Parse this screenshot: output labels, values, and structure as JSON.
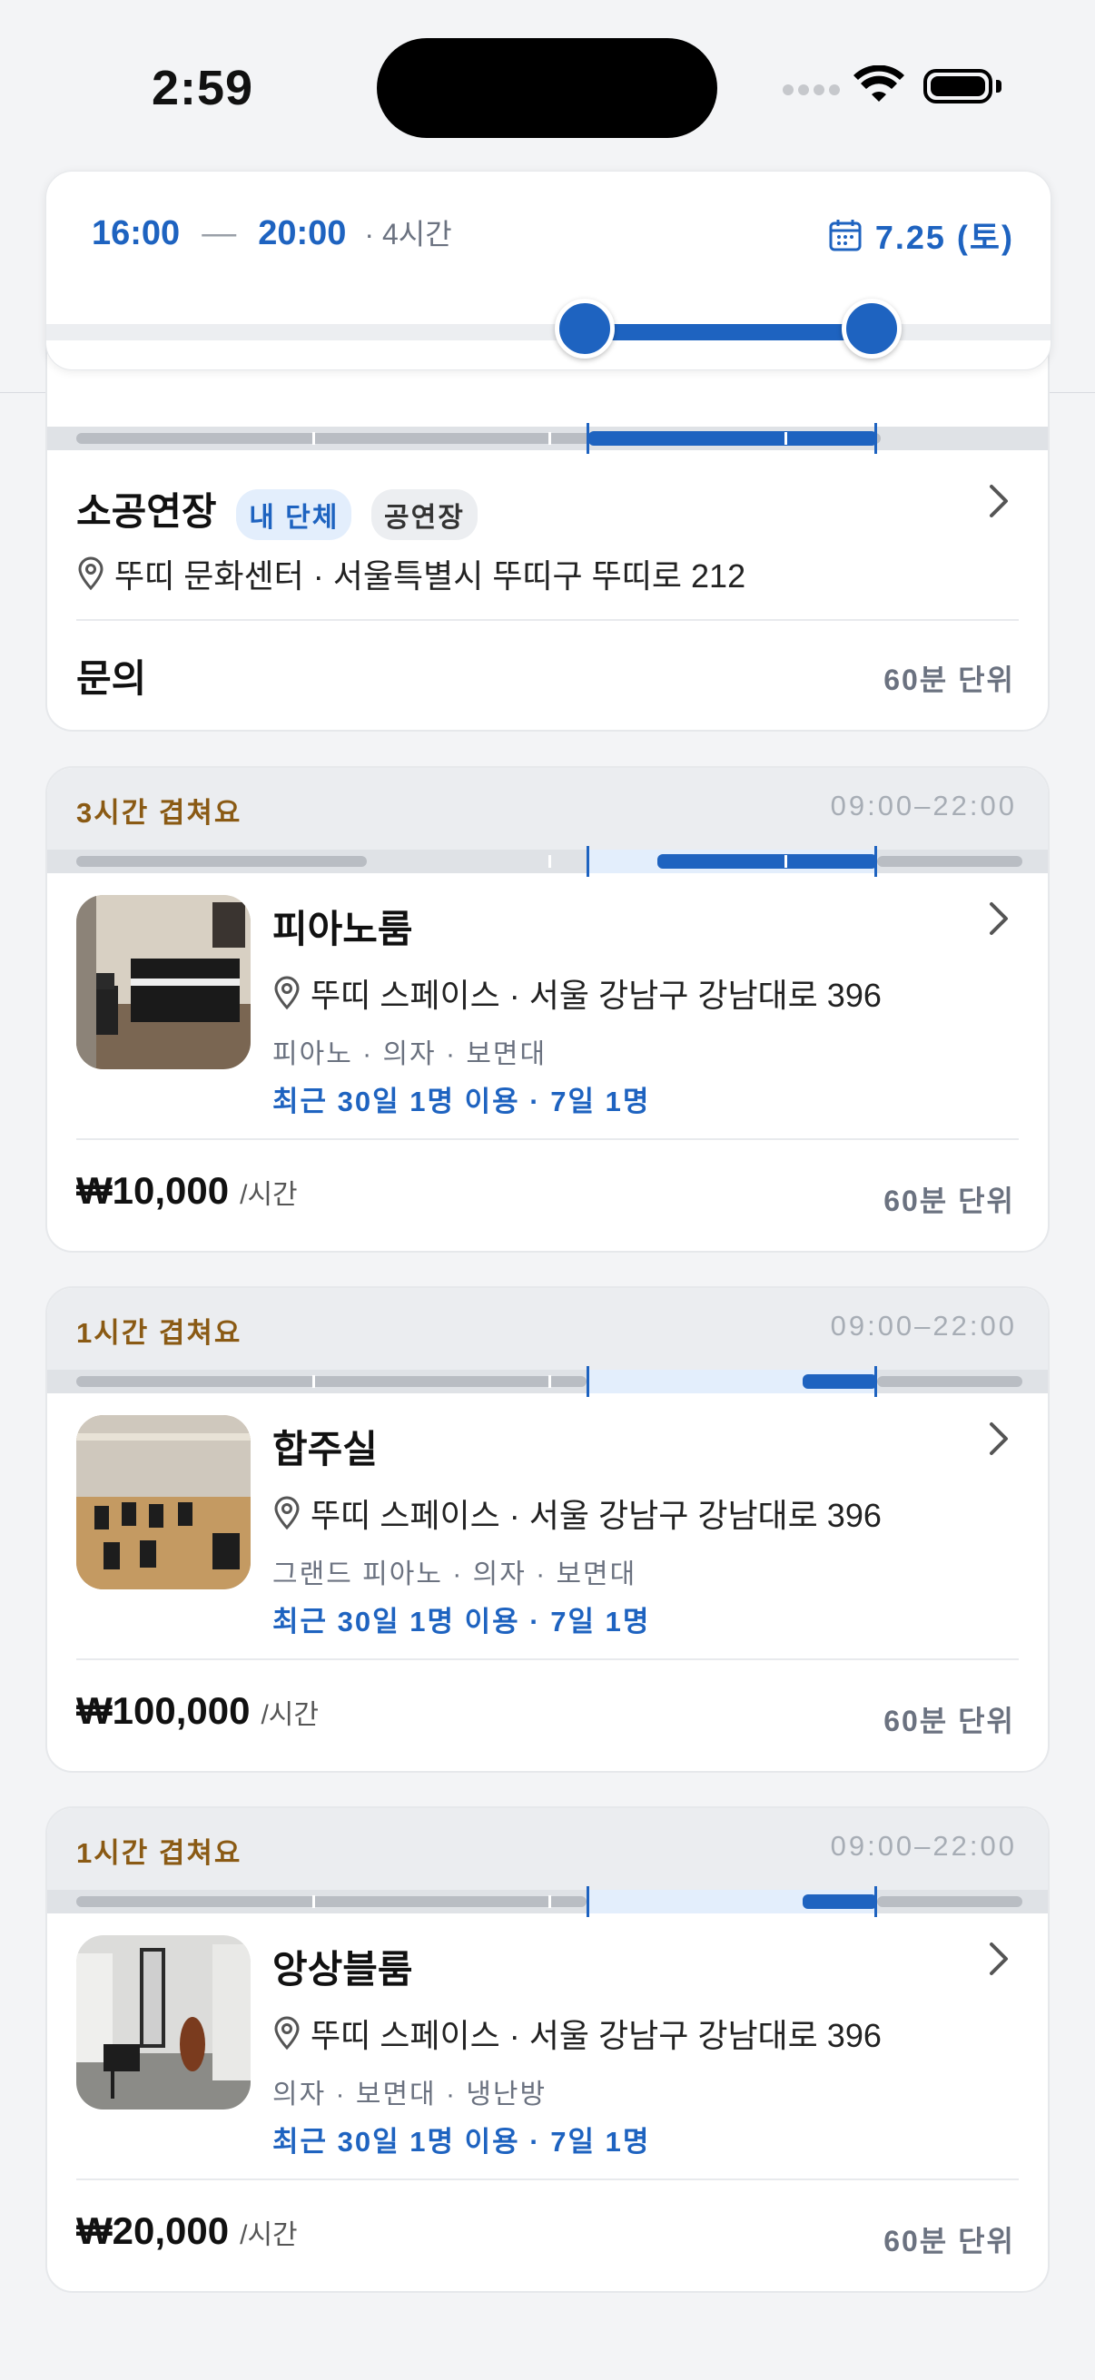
{
  "status_bar": {
    "time": "2:59"
  },
  "filter": {
    "start": "16:00",
    "end": "20:00",
    "duration": "· 4시간",
    "date": "7.25 (토)"
  },
  "cards": [
    {
      "title": "소공연장",
      "badges": [
        "내 단체",
        "공연장"
      ],
      "address": "뚜띠 문화센터 · 서울특별시 뚜띠구 뚜띠로 212",
      "price": "문의",
      "step": "60분 단위"
    },
    {
      "overlap": "3시간 겹쳐요",
      "hours": "09:00–22:00",
      "title": "피아노룸",
      "address": "뚜띠 스페이스 · 서울 강남구 강남대로 396",
      "amenities": "피아노 · 의자 · 보면대",
      "usage": "최근 30일 1명 이용 · 7일 1명",
      "price": "₩10,000",
      "price_unit": "/시간",
      "step": "60분 단위"
    },
    {
      "overlap": "1시간 겹쳐요",
      "hours": "09:00–22:00",
      "title": "합주실",
      "address": "뚜띠 스페이스 · 서울 강남구 강남대로 396",
      "amenities": "그랜드 피아노 · 의자 · 보면대",
      "usage": "최근 30일 1명 이용 · 7일 1명",
      "price": "₩100,000",
      "price_unit": "/시간",
      "step": "60분 단위"
    },
    {
      "overlap": "1시간 겹쳐요",
      "hours": "09:00–22:00",
      "title": "앙상블룸",
      "address": "뚜띠 스페이스 · 서울 강남구 강남대로 396",
      "amenities": "의자 · 보면대 · 냉난방",
      "usage": "최근 30일 1명 이용 · 7일 1명",
      "price": "₩20,000",
      "price_unit": "/시간",
      "step": "60분 단위"
    }
  ]
}
